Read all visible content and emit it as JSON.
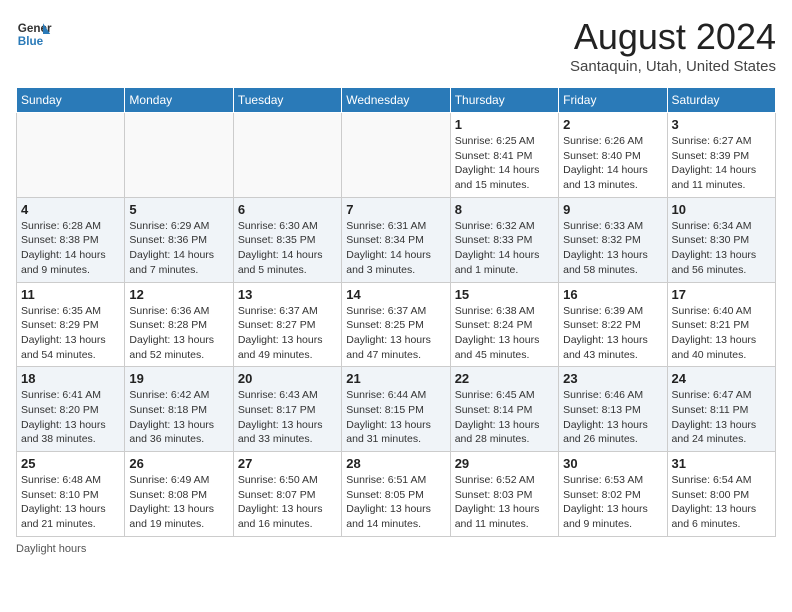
{
  "header": {
    "logo_general": "General",
    "logo_blue": "Blue",
    "month_title": "August 2024",
    "location": "Santaquin, Utah, United States"
  },
  "days_of_week": [
    "Sunday",
    "Monday",
    "Tuesday",
    "Wednesday",
    "Thursday",
    "Friday",
    "Saturday"
  ],
  "footer": {
    "daylight_note": "Daylight hours"
  },
  "weeks": [
    {
      "row_alt": false,
      "days": [
        {
          "num": "",
          "empty": true,
          "info": ""
        },
        {
          "num": "",
          "empty": true,
          "info": ""
        },
        {
          "num": "",
          "empty": true,
          "info": ""
        },
        {
          "num": "",
          "empty": true,
          "info": ""
        },
        {
          "num": "1",
          "empty": false,
          "info": "Sunrise: 6:25 AM\nSunset: 8:41 PM\nDaylight: 14 hours\nand 15 minutes."
        },
        {
          "num": "2",
          "empty": false,
          "info": "Sunrise: 6:26 AM\nSunset: 8:40 PM\nDaylight: 14 hours\nand 13 minutes."
        },
        {
          "num": "3",
          "empty": false,
          "info": "Sunrise: 6:27 AM\nSunset: 8:39 PM\nDaylight: 14 hours\nand 11 minutes."
        }
      ]
    },
    {
      "row_alt": true,
      "days": [
        {
          "num": "4",
          "empty": false,
          "info": "Sunrise: 6:28 AM\nSunset: 8:38 PM\nDaylight: 14 hours\nand 9 minutes."
        },
        {
          "num": "5",
          "empty": false,
          "info": "Sunrise: 6:29 AM\nSunset: 8:36 PM\nDaylight: 14 hours\nand 7 minutes."
        },
        {
          "num": "6",
          "empty": false,
          "info": "Sunrise: 6:30 AM\nSunset: 8:35 PM\nDaylight: 14 hours\nand 5 minutes."
        },
        {
          "num": "7",
          "empty": false,
          "info": "Sunrise: 6:31 AM\nSunset: 8:34 PM\nDaylight: 14 hours\nand 3 minutes."
        },
        {
          "num": "8",
          "empty": false,
          "info": "Sunrise: 6:32 AM\nSunset: 8:33 PM\nDaylight: 14 hours\nand 1 minute."
        },
        {
          "num": "9",
          "empty": false,
          "info": "Sunrise: 6:33 AM\nSunset: 8:32 PM\nDaylight: 13 hours\nand 58 minutes."
        },
        {
          "num": "10",
          "empty": false,
          "info": "Sunrise: 6:34 AM\nSunset: 8:30 PM\nDaylight: 13 hours\nand 56 minutes."
        }
      ]
    },
    {
      "row_alt": false,
      "days": [
        {
          "num": "11",
          "empty": false,
          "info": "Sunrise: 6:35 AM\nSunset: 8:29 PM\nDaylight: 13 hours\nand 54 minutes."
        },
        {
          "num": "12",
          "empty": false,
          "info": "Sunrise: 6:36 AM\nSunset: 8:28 PM\nDaylight: 13 hours\nand 52 minutes."
        },
        {
          "num": "13",
          "empty": false,
          "info": "Sunrise: 6:37 AM\nSunset: 8:27 PM\nDaylight: 13 hours\nand 49 minutes."
        },
        {
          "num": "14",
          "empty": false,
          "info": "Sunrise: 6:37 AM\nSunset: 8:25 PM\nDaylight: 13 hours\nand 47 minutes."
        },
        {
          "num": "15",
          "empty": false,
          "info": "Sunrise: 6:38 AM\nSunset: 8:24 PM\nDaylight: 13 hours\nand 45 minutes."
        },
        {
          "num": "16",
          "empty": false,
          "info": "Sunrise: 6:39 AM\nSunset: 8:22 PM\nDaylight: 13 hours\nand 43 minutes."
        },
        {
          "num": "17",
          "empty": false,
          "info": "Sunrise: 6:40 AM\nSunset: 8:21 PM\nDaylight: 13 hours\nand 40 minutes."
        }
      ]
    },
    {
      "row_alt": true,
      "days": [
        {
          "num": "18",
          "empty": false,
          "info": "Sunrise: 6:41 AM\nSunset: 8:20 PM\nDaylight: 13 hours\nand 38 minutes."
        },
        {
          "num": "19",
          "empty": false,
          "info": "Sunrise: 6:42 AM\nSunset: 8:18 PM\nDaylight: 13 hours\nand 36 minutes."
        },
        {
          "num": "20",
          "empty": false,
          "info": "Sunrise: 6:43 AM\nSunset: 8:17 PM\nDaylight: 13 hours\nand 33 minutes."
        },
        {
          "num": "21",
          "empty": false,
          "info": "Sunrise: 6:44 AM\nSunset: 8:15 PM\nDaylight: 13 hours\nand 31 minutes."
        },
        {
          "num": "22",
          "empty": false,
          "info": "Sunrise: 6:45 AM\nSunset: 8:14 PM\nDaylight: 13 hours\nand 28 minutes."
        },
        {
          "num": "23",
          "empty": false,
          "info": "Sunrise: 6:46 AM\nSunset: 8:13 PM\nDaylight: 13 hours\nand 26 minutes."
        },
        {
          "num": "24",
          "empty": false,
          "info": "Sunrise: 6:47 AM\nSunset: 8:11 PM\nDaylight: 13 hours\nand 24 minutes."
        }
      ]
    },
    {
      "row_alt": false,
      "days": [
        {
          "num": "25",
          "empty": false,
          "info": "Sunrise: 6:48 AM\nSunset: 8:10 PM\nDaylight: 13 hours\nand 21 minutes."
        },
        {
          "num": "26",
          "empty": false,
          "info": "Sunrise: 6:49 AM\nSunset: 8:08 PM\nDaylight: 13 hours\nand 19 minutes."
        },
        {
          "num": "27",
          "empty": false,
          "info": "Sunrise: 6:50 AM\nSunset: 8:07 PM\nDaylight: 13 hours\nand 16 minutes."
        },
        {
          "num": "28",
          "empty": false,
          "info": "Sunrise: 6:51 AM\nSunset: 8:05 PM\nDaylight: 13 hours\nand 14 minutes."
        },
        {
          "num": "29",
          "empty": false,
          "info": "Sunrise: 6:52 AM\nSunset: 8:03 PM\nDaylight: 13 hours\nand 11 minutes."
        },
        {
          "num": "30",
          "empty": false,
          "info": "Sunrise: 6:53 AM\nSunset: 8:02 PM\nDaylight: 13 hours\nand 9 minutes."
        },
        {
          "num": "31",
          "empty": false,
          "info": "Sunrise: 6:54 AM\nSunset: 8:00 PM\nDaylight: 13 hours\nand 6 minutes."
        }
      ]
    }
  ]
}
